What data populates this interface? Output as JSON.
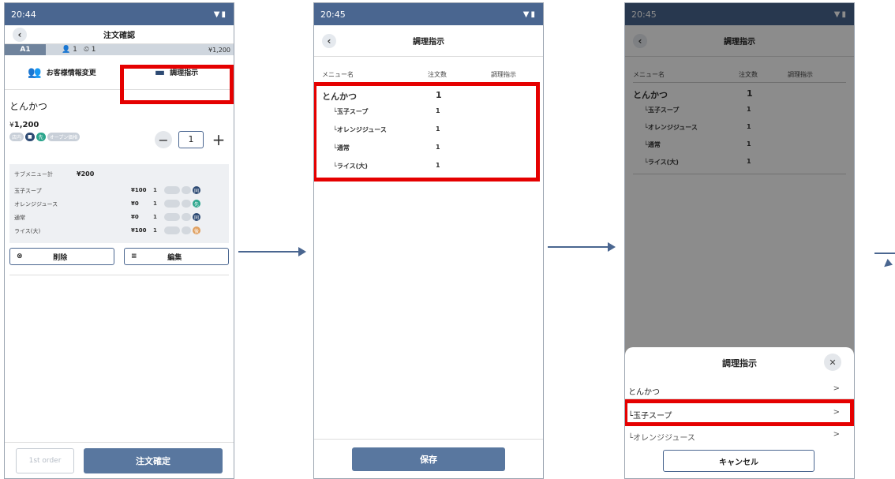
{
  "screen1": {
    "time": "20:44",
    "title": "注文確認",
    "table_no": "A1",
    "guests": "1",
    "count": "1",
    "price_top": "¥1,200",
    "action_customer": "お客様情報変更",
    "action_cooking": "調理指示",
    "item_name": "とんかつ",
    "item_price_prefix": "¥",
    "item_price": "1,200",
    "tag_dine": "店内",
    "tag_msg": "■",
    "tag_first": "先",
    "tag_open": "オープン価格",
    "quantity": "1",
    "submenu_label": "サブメニュー計",
    "submenu_total": "¥200",
    "submenu_items": [
      {
        "name": "玉子スープ",
        "price": "¥100",
        "qty": "1",
        "dot": "同",
        "dot_color": "#2d4a73"
      },
      {
        "name": "オレンジジュース",
        "price": "¥0",
        "qty": "1",
        "dot": "先",
        "dot_color": "#2ba58c"
      },
      {
        "name": "通常",
        "price": "¥0",
        "qty": "1",
        "dot": "同",
        "dot_color": "#2d4a73"
      },
      {
        "name": "ライス(大)",
        "price": "¥100",
        "qty": "1",
        "dot": "後",
        "dot_color": "#e0a060"
      }
    ],
    "delete_label": "削除",
    "edit_label": "編集",
    "first_order_label": "1st order",
    "confirm_label": "注文確定"
  },
  "screen2": {
    "time": "20:45",
    "title": "調理指示",
    "col_menu": "メニュー名",
    "col_qty": "注文数",
    "col_instr": "調理指示",
    "main_item": {
      "name": "とんかつ",
      "qty": "1"
    },
    "sub_items": [
      {
        "name": "└玉子スープ",
        "qty": "1"
      },
      {
        "name": "└オレンジジュース",
        "qty": "1"
      },
      {
        "name": "└通常",
        "qty": "1"
      },
      {
        "name": "└ライス(大)",
        "qty": "1"
      }
    ],
    "save_label": "保存"
  },
  "screen3": {
    "time": "20:45",
    "sheet_title": "調理指示",
    "sheet_items": [
      {
        "name": "とんかつ",
        "chevron": ">"
      },
      {
        "name": "└玉子スープ",
        "chevron": ">"
      },
      {
        "name": "└オレンジジュース",
        "chevron": ">"
      }
    ],
    "cancel_label": "キャンセル"
  },
  "icons": {
    "back": "‹",
    "close": "✕",
    "minus": "−",
    "plus": "+",
    "status": "▼▮"
  },
  "colors": {
    "statusbar": "#4a6690",
    "highlight": "#e50000",
    "primary_button": "#59779f"
  }
}
